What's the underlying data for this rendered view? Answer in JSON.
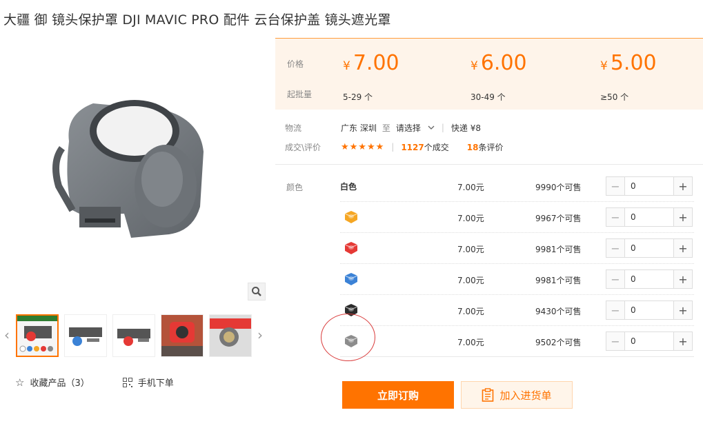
{
  "product": {
    "title": "大疆 御 镜头保护罩 DJI MAVIC PRO 配件 云台保护盖 镜头遮光罩"
  },
  "price_box": {
    "price_label": "价格",
    "moq_label": "起批量",
    "currency": "¥",
    "tiers": [
      {
        "price": "7.00",
        "range": "5-29 个"
      },
      {
        "price": "6.00",
        "range": "30-49 个"
      },
      {
        "price": "5.00",
        "range": "≥50 个"
      }
    ]
  },
  "logistics": {
    "label": "物流",
    "from": "广东 深圳",
    "to_word": "至",
    "destination": "请选择",
    "shipping": "快递 ¥8"
  },
  "deals": {
    "label": "成交\\评价",
    "stars": "★★★★★",
    "count": "1127",
    "count_suffix": "个成交",
    "reviews": "18",
    "reviews_suffix": "条评价"
  },
  "sku": {
    "label": "颜色",
    "rows": [
      {
        "name": "白色",
        "swatch": "none",
        "price": "7.00元",
        "stock": "9990个可售",
        "qty": "0"
      },
      {
        "name": "",
        "swatch": "#f5a623",
        "price": "7.00元",
        "stock": "9967个可售",
        "qty": "0"
      },
      {
        "name": "",
        "swatch": "#e53935",
        "price": "7.00元",
        "stock": "9981个可售",
        "qty": "0"
      },
      {
        "name": "",
        "swatch": "#3b82d6",
        "price": "7.00元",
        "stock": "9981个可售",
        "qty": "0"
      },
      {
        "name": "",
        "swatch": "#2b2b2b",
        "price": "7.00元",
        "stock": "9430个可售",
        "qty": "0"
      },
      {
        "name": "",
        "swatch": "#8c8c8c",
        "price": "7.00元",
        "stock": "9502个可售",
        "qty": "0"
      }
    ]
  },
  "actions": {
    "buy_now": "立即订购",
    "add_to_list": "加入进货单",
    "favorite": "收藏产品（3）",
    "mobile_order": "手机下单"
  },
  "colors": {
    "accent": "#ff7300",
    "annotation": "#d93a3a"
  }
}
